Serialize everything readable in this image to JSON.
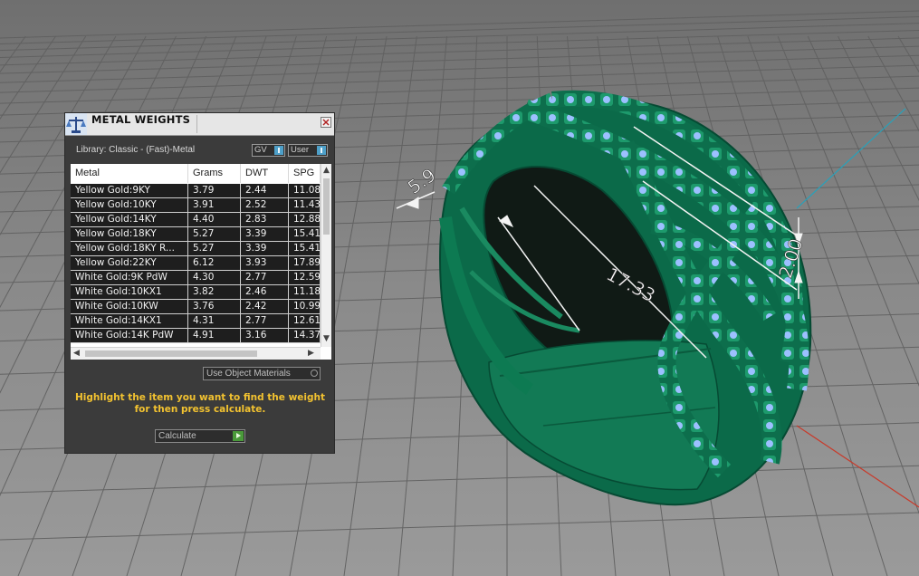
{
  "colors": {
    "viewport_bg": "#8f8f8f",
    "grid": "#6a6a6a",
    "ring_green": "#0f7a55",
    "gem_blue": "#8fb6ff",
    "accent_text": "#f2c230"
  },
  "panel": {
    "title": "METAL WEIGHTS",
    "title_icon": "scale-icon",
    "close_icon": "close-icon",
    "library_label": "Library: Classic - (Fast)-Metal",
    "toggle_gv": "GV",
    "toggle_user": "User",
    "table": {
      "columns": [
        "Metal",
        "Grams",
        "DWT",
        "SPG"
      ],
      "rows": [
        [
          "Yellow Gold:9KY",
          "3.79",
          "2.44",
          "11.08"
        ],
        [
          "Yellow Gold:10KY",
          "3.91",
          "2.52",
          "11.43"
        ],
        [
          "Yellow Gold:14KY",
          "4.40",
          "2.83",
          "12.88"
        ],
        [
          "Yellow Gold:18KY",
          "5.27",
          "3.39",
          "15.41"
        ],
        [
          "Yellow Gold:18KY R...",
          "5.27",
          "3.39",
          "15.41"
        ],
        [
          "Yellow Gold:22KY",
          "6.12",
          "3.93",
          "17.89"
        ],
        [
          "White Gold:9K PdW",
          "4.30",
          "2.77",
          "12.59"
        ],
        [
          "White Gold:10KX1",
          "3.82",
          "2.46",
          "11.18"
        ],
        [
          "White Gold:10KW",
          "3.76",
          "2.42",
          "10.99"
        ],
        [
          "White Gold:14KX1",
          "4.31",
          "2.77",
          "12.61"
        ],
        [
          "White Gold:14K PdW",
          "4.91",
          "3.16",
          "14.37"
        ]
      ]
    },
    "use_object_materials": "Use Object Materials",
    "instruction": "Highlight the item you want to find the weight for then press calculate.",
    "calculate_label": "Calculate"
  },
  "viewport": {
    "dimensions": [
      "5.9",
      "17.33",
      "2.00"
    ]
  }
}
